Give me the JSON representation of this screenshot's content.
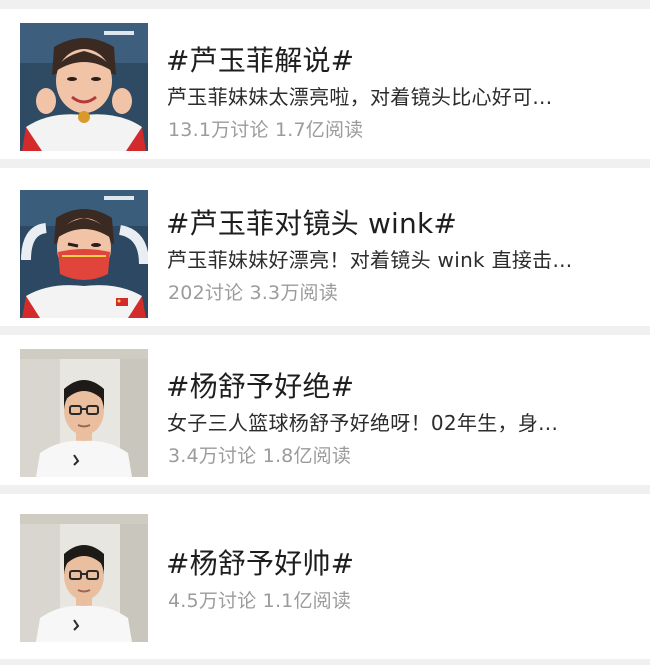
{
  "topics": [
    {
      "title": "#芦玉菲解说#",
      "description": "芦玉菲妹妹太漂亮啦，对着镜头比心好可...",
      "meta": "13.1万讨论 1.7亿阅读",
      "thumbnail_icon": "gymnast-photo"
    },
    {
      "title": "#芦玉菲对镜头 wink#",
      "description": "芦玉菲妹妹好漂亮！对着镜头 wink 直接击...",
      "meta": "202讨论 3.3万阅读",
      "thumbnail_icon": "gymnast-masked-photo"
    },
    {
      "title": "#杨舒予好绝#",
      "description": "女子三人篮球杨舒予好绝呀！02年生，身...",
      "meta": "3.4万讨论 1.8亿阅读",
      "thumbnail_icon": "basketball-player-photo"
    },
    {
      "title": "#杨舒予好帅#",
      "description": "",
      "meta": "4.5万讨论 1.1亿阅读",
      "thumbnail_icon": "basketball-player-photo"
    }
  ],
  "colors": {
    "title": "#1e1e1e",
    "description": "#2c2c2c",
    "meta": "#9b9b9b",
    "separator": "#f0f0f1",
    "background": "#ffffff"
  }
}
